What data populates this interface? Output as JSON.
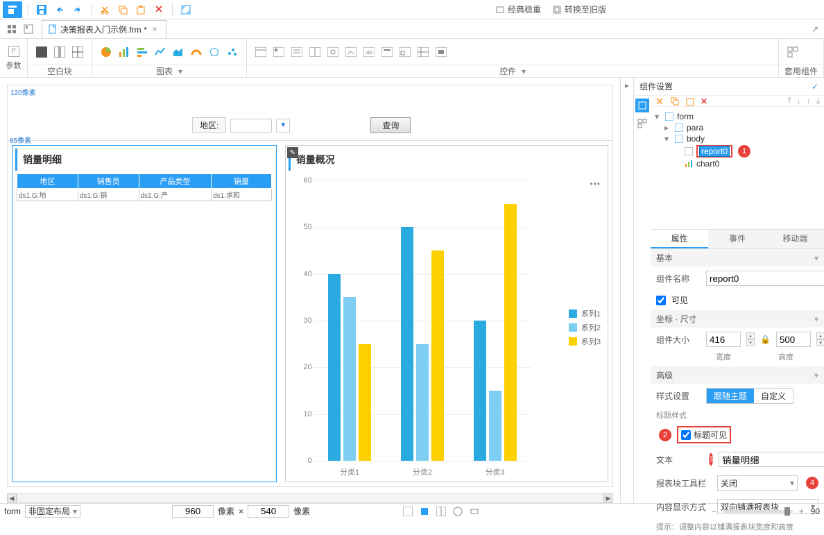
{
  "top": {
    "classic": "经典稳重",
    "switch_old": "转换至旧版"
  },
  "tab": {
    "filename": "决策报表入门示例.frm *"
  },
  "ribbon": {
    "params_label": "参数",
    "blank_label": "空白块",
    "chart_label": "图表",
    "widgets_label": "控件",
    "reuse_label": "套用组件"
  },
  "param_pane": {
    "hint": "120像素",
    "region_label": "地区:",
    "query_btn": "查询"
  },
  "report_card": {
    "hint": "85像素",
    "title": "销量明细",
    "headers": [
      "地区",
      "销售员",
      "产品类型",
      "销量"
    ],
    "cells": [
      "ds1.G:地",
      "ds1.G:销",
      "ds1.G:产",
      "ds1.求和"
    ]
  },
  "chart_card": {
    "title": "销量概况"
  },
  "chart_data": {
    "type": "bar",
    "categories": [
      "分类1",
      "分类2",
      "分类3"
    ],
    "series": [
      {
        "name": "系列1",
        "values": [
          40,
          50,
          30
        ],
        "color": "#29abe2"
      },
      {
        "name": "系列2",
        "values": [
          35,
          25,
          15
        ],
        "color": "#7ecef4"
      },
      {
        "name": "系列3",
        "values": [
          25,
          45,
          55
        ],
        "color": "#fdd000"
      }
    ],
    "ylim": [
      0,
      60
    ],
    "yticks": [
      0,
      10,
      20,
      30,
      40,
      50,
      60
    ]
  },
  "right": {
    "title": "组件设置",
    "tree": {
      "form": "form",
      "para": "para",
      "body": "body",
      "report0": "report0",
      "chart0": "chart0"
    },
    "tabs": {
      "attr": "属性",
      "event": "事件",
      "mobile": "移动端"
    },
    "sections": {
      "basic": "基本",
      "coord": "坐标 · 尺寸",
      "advanced": "高级"
    },
    "labels": {
      "comp_name": "组件名称",
      "visible": "可见",
      "comp_size": "组件大小",
      "width": "宽度",
      "height": "高度",
      "style_setting": "样式设置",
      "follow_theme": "跟随主题",
      "custom": "自定义",
      "title_style": "标题样式",
      "title_visible": "标题可见",
      "text": "文本",
      "toolbar": "报表块工具栏",
      "closed": "关闭",
      "display_mode": "内容显示方式",
      "fill_both": "双向铺满报表块",
      "hint": "提示：调整内容以铺满报表块宽度和高度"
    },
    "values": {
      "comp_name": "report0",
      "width": "416",
      "height": "500",
      "title_text": "销量明细"
    }
  },
  "status": {
    "form": "form",
    "layout": "非固定布局",
    "w": "960",
    "h": "540",
    "unit": "像素",
    "zoom": "90"
  },
  "annotations": {
    "1": "1",
    "2": "2",
    "3": "3",
    "4": "4"
  }
}
